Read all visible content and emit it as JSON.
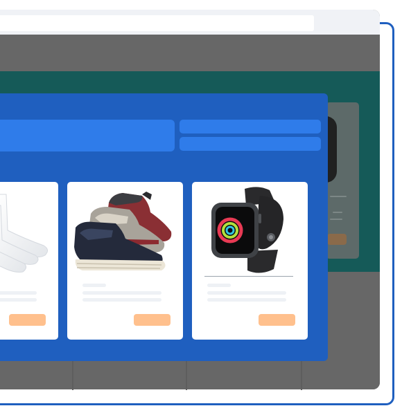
{
  "window": {
    "address_value": ""
  },
  "panel": {
    "search_value": "",
    "pill_1_label": "",
    "pill_2_label": ""
  },
  "products": [
    {
      "image": "socks-image",
      "button_label": ""
    },
    {
      "image": "sneakers-image",
      "button_label": ""
    },
    {
      "image": "smartwatch-image",
      "button_label": ""
    }
  ],
  "colors": {
    "panel_blue": "#1f5fbf",
    "search_blue": "#2f7cea",
    "teal": "#155a58",
    "window_grey": "#676767",
    "button_peach": "#ffc08d",
    "topbar": "#f0f2f6"
  }
}
